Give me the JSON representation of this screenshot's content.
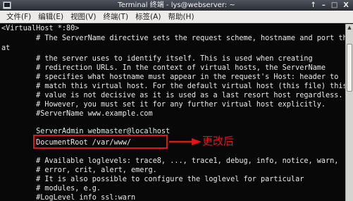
{
  "window": {
    "title": "Terminal 终端 - lys@webserver: ~",
    "controls": {
      "up": "↑",
      "minimize": "–",
      "maximize": "□",
      "close": "X"
    }
  },
  "menu": {
    "items": [
      "文件(F)",
      "编辑(E)",
      "视图(V)",
      "终端(T)",
      "标签(A)",
      "帮助(H)"
    ]
  },
  "terminal": {
    "lines": [
      "<VirtualHost *:80>",
      "        # The ServerName directive sets the request scheme, hostname and port th",
      "at",
      "        # the server uses to identify itself. This is used when creating",
      "        # redirection URLs. In the context of virtual hosts, the ServerName",
      "        # specifies what hostname must appear in the request's Host: header to",
      "        # match this virtual host. For the default virtual host (this file) this",
      "        # value is not decisive as it is used as a last resort host regardless.",
      "        # However, you must set it for any further virtual host explicitly.",
      "        #ServerName www.example.com",
      "",
      "        ServerAdmin webmaster@localhost",
      "        DocumentRoot /var/www/",
      "",
      "        # Available loglevels: trace8, ..., trace1, debug, info, notice, warn,",
      "        # error, crit, alert, emerg.",
      "        # It is also possible to configure the loglevel for particular",
      "        # modules, e.g.",
      "        #LogLevel info ssl:warn"
    ]
  },
  "annotation": {
    "label": "更改后",
    "color": "#e0141b"
  },
  "icons": {
    "app": "terminal-icon",
    "scroll_up": "scroll-up-arrow-icon"
  }
}
